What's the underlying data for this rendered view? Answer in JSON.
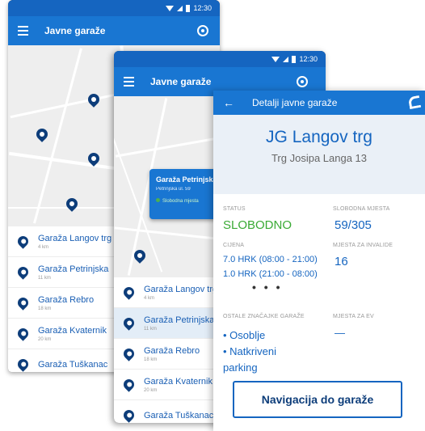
{
  "screen1": {
    "status_time": "12:30",
    "app_title": "Javne garaže",
    "list": [
      {
        "name": "Garaža Langov trg",
        "distance": "4 km"
      },
      {
        "name": "Garaža Petrinjska",
        "distance": "11 km"
      },
      {
        "name": "Garaža Rebro",
        "distance": "18 km"
      },
      {
        "name": "Garaža Kvaternik",
        "distance": "20 km"
      },
      {
        "name": "Garaža Tuškanac",
        "distance": ""
      }
    ]
  },
  "screen2": {
    "status_time": "12:30",
    "app_title": "Javne garaže",
    "map_card": {
      "name": "Garaža Petrinjska",
      "address": "Petrinjska ul. 59",
      "status": "Slobodna mjesta"
    },
    "list": [
      {
        "name": "Garaža Langov trg",
        "distance": "4 km"
      },
      {
        "name": "Garaža Petrinjska",
        "distance": "11 km"
      },
      {
        "name": "Garaža Rebro",
        "distance": "18 km"
      },
      {
        "name": "Garaža Kvaternik",
        "distance": "20 km"
      },
      {
        "name": "Garaža Tuškanac",
        "distance": ""
      }
    ]
  },
  "detail": {
    "title": "Detalji javne garaže",
    "garage_name": "JG Langov trg",
    "garage_address": "Trg Josipa Langa 13",
    "status_label": "STATUS",
    "status_value": "SLOBODNO",
    "free_places_label": "SLOBODNA MJESTA",
    "free_places_value": "59/305",
    "price_label": "CIJENA",
    "price_day": "7.0 HRK (08:00 - 21:00)",
    "price_night": "1.0 HRK (21:00 - 08:00)",
    "more": "• • •",
    "invalid_label": "MJESTA ZA INVALIDE",
    "invalid_value": "16",
    "features_label": "OSTALE ZNAČAJKE GARAŽE",
    "features": [
      "• Osoblje",
      "• Natkriveni parking"
    ],
    "ev_label": "MJESTA ZA EV",
    "ev_value": "—",
    "nav_button": "Navigacija do garaže"
  },
  "colors": {
    "primary": "#1976d2",
    "status_bar": "#1565c0",
    "pin": "#0d3d7a",
    "status_free": "#3aaa35"
  },
  "icons": [
    "menu-icon",
    "my-location-icon",
    "map-pin-icon",
    "back-arrow-icon",
    "phone-icon"
  ]
}
